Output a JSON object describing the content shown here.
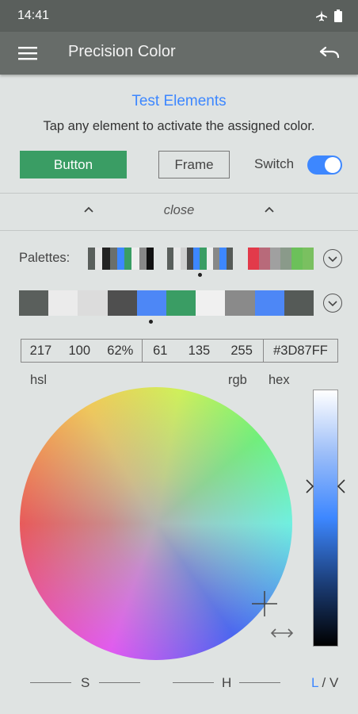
{
  "status_bar": {
    "time": "14:41",
    "icons": [
      "airplane-icon",
      "battery-icon"
    ]
  },
  "app_bar": {
    "title": "Precision Color",
    "icons": [
      "menu-icon",
      "undo-icon"
    ]
  },
  "test_elements": {
    "title": "Test Elements",
    "hint": "Tap any element to activate the assigned color.",
    "button_label": "Button",
    "frame_label": "Frame",
    "switch_label": "Switch",
    "switch_on": true
  },
  "close_bar": {
    "label": "close"
  },
  "palettes": {
    "label": "Palettes:",
    "list": [
      {
        "colors": [
          "#5a5f5c",
          "#e6e6e6",
          "#222222",
          "#6a6f6c",
          "#3d87ff",
          "#3a9d64",
          "#eeeeee",
          "#888888",
          "#111111"
        ]
      },
      {
        "colors": [
          "#5a5f5c",
          "#e8e8e8",
          "#d0d0d0",
          "#4a4a4a",
          "#3d87ff",
          "#3a9d64",
          "#eeeeee",
          "#888888",
          "#3d87ff",
          "#555a57"
        ]
      },
      {
        "colors": [
          "#e23a4a",
          "#b86a7a",
          "#a0a0a0",
          "#8a9a8a",
          "#6cc05a",
          "#7ac060"
        ]
      }
    ],
    "active": [
      "#5a5f5c",
      "#ebebeb",
      "#dcdcdc",
      "#4f4f4f",
      "#4d87f6",
      "#3a9d64",
      "#f0f0f0",
      "#8a8a8a",
      "#4d87f6",
      "#555a57"
    ]
  },
  "values": {
    "hsl": {
      "h": "217",
      "s": "100",
      "l": "62%"
    },
    "rgb": {
      "r": "61",
      "g": "135",
      "b": "255"
    },
    "hex": "#3D87FF",
    "labels": {
      "hsl": "hsl",
      "rgb": "rgb",
      "hex": "hex"
    }
  },
  "bottom": {
    "s_label": "S",
    "h_label": "H",
    "l_label": "L",
    "separator": " / ",
    "v_label": "V"
  },
  "colors": {
    "accent": "#3d87ff",
    "app_bar": "#676c69",
    "status_bar": "#5a5f5c",
    "button_green": "#3a9d64",
    "background": "#dfe3e2"
  }
}
